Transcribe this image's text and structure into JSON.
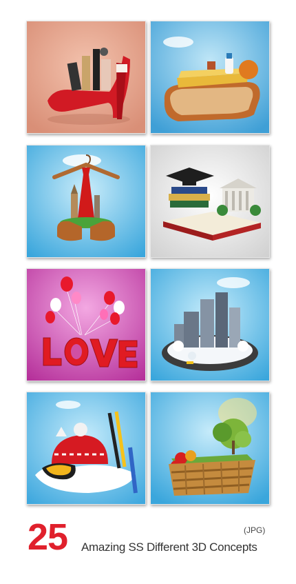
{
  "footer": {
    "count": "25",
    "title": "Amazing SS Different 3D Concepts",
    "format": "(JPG)"
  },
  "colors": {
    "accent_red": "#e0202c",
    "sky_blue": "#3fa9de",
    "peach": "#e9a58e",
    "love_pink": "#cf4fa8"
  },
  "tiles": [
    {
      "subject": "red high-heel shoe with cosmetics"
    },
    {
      "subject": "bread slice with wheat field and milk bottle"
    },
    {
      "subject": "clothes hanger with tie, Big Ben and shoes"
    },
    {
      "subject": "graduation cap on books and diploma"
    },
    {
      "subject": "LOVE letters with balloons"
    },
    {
      "subject": "winter city island with skyscrapers"
    },
    {
      "subject": "ski goggles, hat and skis on snow"
    },
    {
      "subject": "wicker basket with fruit and trees"
    }
  ]
}
